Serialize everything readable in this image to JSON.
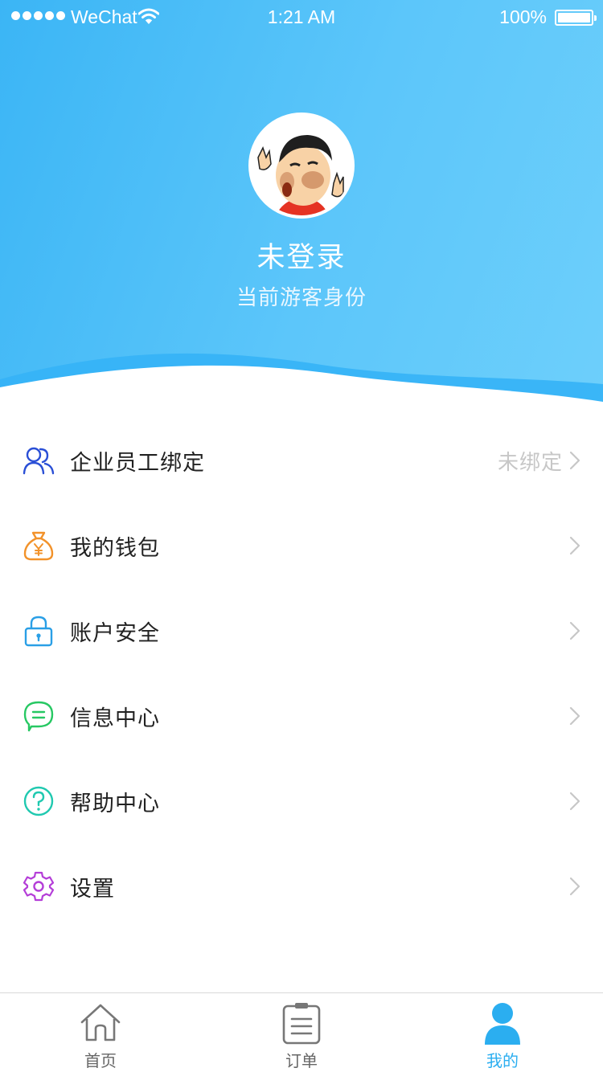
{
  "status_bar": {
    "carrier": "WeChat",
    "time": "1:21 AM",
    "battery": "100%"
  },
  "profile": {
    "name": "未登录",
    "subtitle": "当前游客身份"
  },
  "menu": [
    {
      "label": "企业员工绑定",
      "value": "未绑定",
      "icon": "users-icon",
      "color": "#2a4fd6"
    },
    {
      "label": "我的钱包",
      "value": "",
      "icon": "money-bag-icon",
      "color": "#f2922a"
    },
    {
      "label": "账户安全",
      "value": "",
      "icon": "lock-icon",
      "color": "#2a9fe6"
    },
    {
      "label": "信息中心",
      "value": "",
      "icon": "message-icon",
      "color": "#27c863"
    },
    {
      "label": "帮助中心",
      "value": "",
      "icon": "help-icon",
      "color": "#20c9b0"
    },
    {
      "label": "设置",
      "value": "",
      "icon": "gear-icon",
      "color": "#b43ed8"
    }
  ],
  "tabbar": [
    {
      "label": "首页",
      "icon": "home-icon",
      "active": false
    },
    {
      "label": "订单",
      "icon": "order-list-icon",
      "active": false
    },
    {
      "label": "我的",
      "icon": "profile-icon",
      "active": true
    }
  ],
  "colors": {
    "header_start": "#3bb5f5",
    "header_end": "#6dcffb",
    "tab_active": "#2baef0",
    "tab_inactive": "#666666"
  }
}
